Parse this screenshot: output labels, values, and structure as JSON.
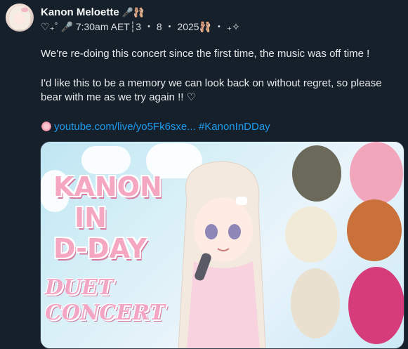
{
  "author": {
    "display_name": "Kanon Meloette",
    "name_emojis": "🎤🩰",
    "meta": "♡₊˚ 🎤 7:30am AET┆3 ・ 8 ・ 2025🩰 ・ ₊✧"
  },
  "post": {
    "paragraph1": "We're re-doing this concert since the first time, the music was off time !",
    "paragraph2": "I'd like this to be a memory we can look back on without regret, so please bear with me as we try again !! ♡",
    "link_text": "youtube.com/live/yo5Fk6sxe...",
    "hashtag": "#KanonInDDay"
  },
  "media": {
    "title_line1": "KANON",
    "title_line2": "IN",
    "title_line3": "D-DAY",
    "subtitle_line1": "DUET",
    "subtitle_line2": "CONCERT"
  },
  "colors": {
    "background": "#15202b",
    "link": "#1d9bf0",
    "text": "#e7e9ea",
    "poster_pink": "#f5a7c2"
  }
}
